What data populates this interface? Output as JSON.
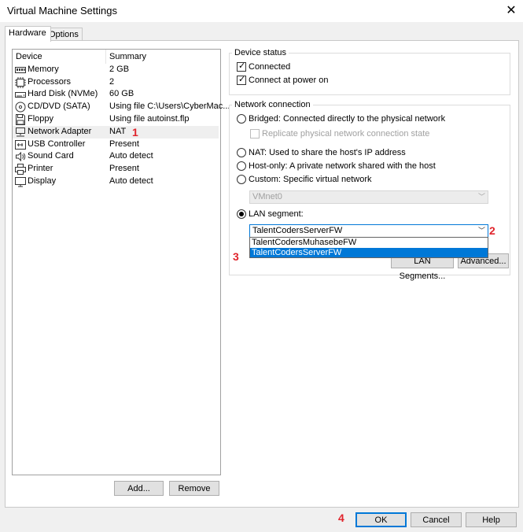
{
  "window": {
    "title": "Virtual Machine Settings",
    "close_glyph": "✕"
  },
  "tabs": [
    {
      "label": "Hardware"
    },
    {
      "label": "Options"
    }
  ],
  "device_list": {
    "headers": {
      "device": "Device",
      "summary": "Summary"
    },
    "rows": [
      {
        "icon": "memory-icon",
        "device": "Memory",
        "summary": "2 GB"
      },
      {
        "icon": "processor-icon",
        "device": "Processors",
        "summary": "2"
      },
      {
        "icon": "hard-disk-icon",
        "device": "Hard Disk (NVMe)",
        "summary": "60 GB"
      },
      {
        "icon": "cd-dvd-icon",
        "device": "CD/DVD (SATA)",
        "summary": "Using file C:\\Users\\CyberMac..."
      },
      {
        "icon": "floppy-icon",
        "device": "Floppy",
        "summary": "Using file autoinst.flp"
      },
      {
        "icon": "network-adapter-icon",
        "device": "Network Adapter",
        "summary": "NAT"
      },
      {
        "icon": "usb-icon",
        "device": "USB Controller",
        "summary": "Present"
      },
      {
        "icon": "sound-card-icon",
        "device": "Sound Card",
        "summary": "Auto detect"
      },
      {
        "icon": "printer-icon",
        "device": "Printer",
        "summary": "Present"
      },
      {
        "icon": "display-icon",
        "device": "Display",
        "summary": "Auto detect"
      }
    ]
  },
  "left_buttons": {
    "add": "Add...",
    "remove": "Remove"
  },
  "device_status": {
    "legend": "Device status",
    "connected": "Connected",
    "connect_at_power_on": "Connect at power on"
  },
  "network_connection": {
    "legend": "Network connection",
    "bridged": "Bridged: Connected directly to the physical network",
    "replicate": "Replicate physical network connection state",
    "nat": "NAT: Used to share the host's IP address",
    "host_only": "Host-only: A private network shared with the host",
    "custom": "Custom: Specific virtual network",
    "custom_value": "VMnet0",
    "lan_segment": "LAN segment:",
    "lan_value": "TalentCodersServerFW",
    "lan_options": [
      "TalentCodersMuhasebeFW",
      "TalentCodersServerFW"
    ],
    "lan_segments_button": "LAN Segments...",
    "advanced_button": "Advanced..."
  },
  "footer": {
    "ok": "OK",
    "cancel": "Cancel",
    "help": "Help"
  },
  "annotations": [
    "1",
    "2",
    "3",
    "4"
  ],
  "colors": {
    "accent": "#0078d7",
    "annotation": "#e0242c",
    "selection": "#0078d7"
  }
}
